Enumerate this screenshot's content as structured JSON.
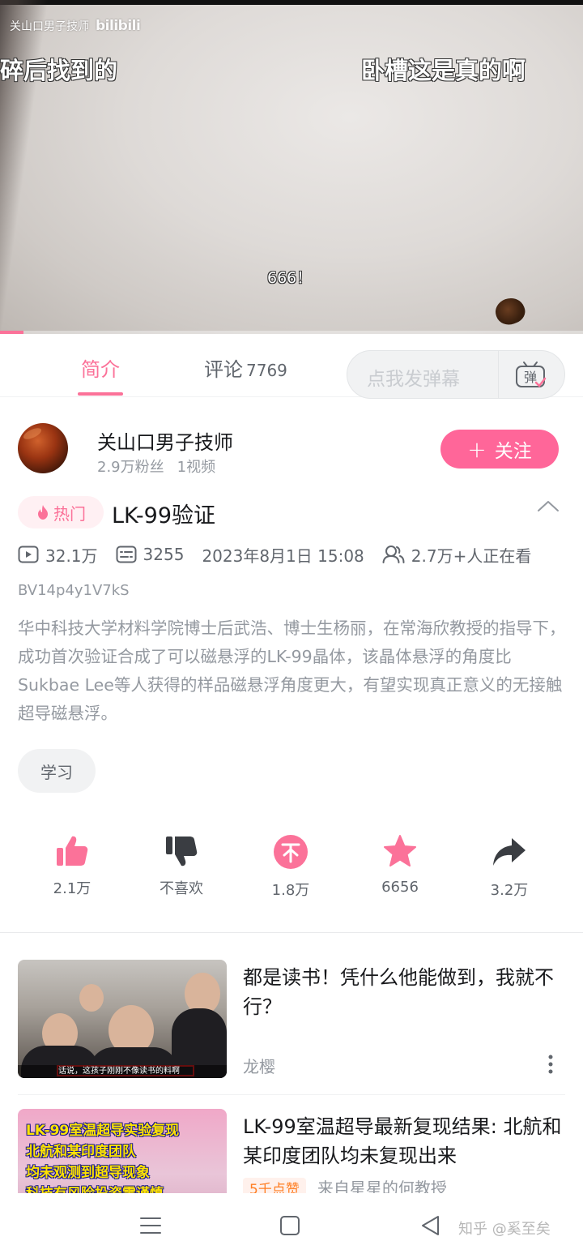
{
  "player": {
    "watermark": "关山口男子技师",
    "watermark_logo": "bilibili",
    "danmaku": [
      "碎后找到的",
      "卧槽这是真的啊",
      "666！"
    ],
    "progress_fraction": 0.04
  },
  "tabs": {
    "intro_label": "简介",
    "comments_label": "评论",
    "comments_count": "7769",
    "danmu_placeholder": "点我发弹幕",
    "danmu_button": "弹"
  },
  "uploader": {
    "name": "关山口男子技师",
    "fans": "2.9万粉丝",
    "videos": "1视频",
    "follow_label": "关注"
  },
  "video": {
    "hot_badge": "热门",
    "title": "LK-99验证",
    "views": "32.1万",
    "danmaku_count": "3255",
    "publish_time": "2023年8月1日 15:08",
    "watching": "2.7万+人正在看",
    "bvid": "BV14p4y1V7kS",
    "description": "华中科技大学材料学院博士后武浩、博士生杨丽，在常海欣教授的指导下，成功首次验证合成了可以磁悬浮的LK-99晶体，该晶体悬浮的角度比Sukbae Lee等人获得的样品磁悬浮角度更大，有望实现真正意义的无接触超导磁悬浮。",
    "tag": "学习"
  },
  "actions": {
    "like": "2.1万",
    "dislike": "不喜欢",
    "coin": "1.8万",
    "favorite": "6656",
    "share": "3.2万",
    "accent_color": "#fb7299"
  },
  "recommendations": [
    {
      "title": "都是读书！凭什么他能做到，我就不行？",
      "author": "龙樱",
      "thumb_caption": "话说，这孩子刚刚不像读书的料啊"
    },
    {
      "title": "LK-99室温超导最新复现结果: 北航和某印度团队均未复现出来",
      "likes_badge": "5千点赞",
      "author": "来自星星的何教授",
      "thumb_lines": [
        "LK-99室温超导实验复现",
        "北航和某印度团队",
        "均未观测到超导现象",
        "科技有风险投资需谨慎"
      ]
    }
  ],
  "bottom": {
    "watermark": "知乎 @奚至矣"
  }
}
